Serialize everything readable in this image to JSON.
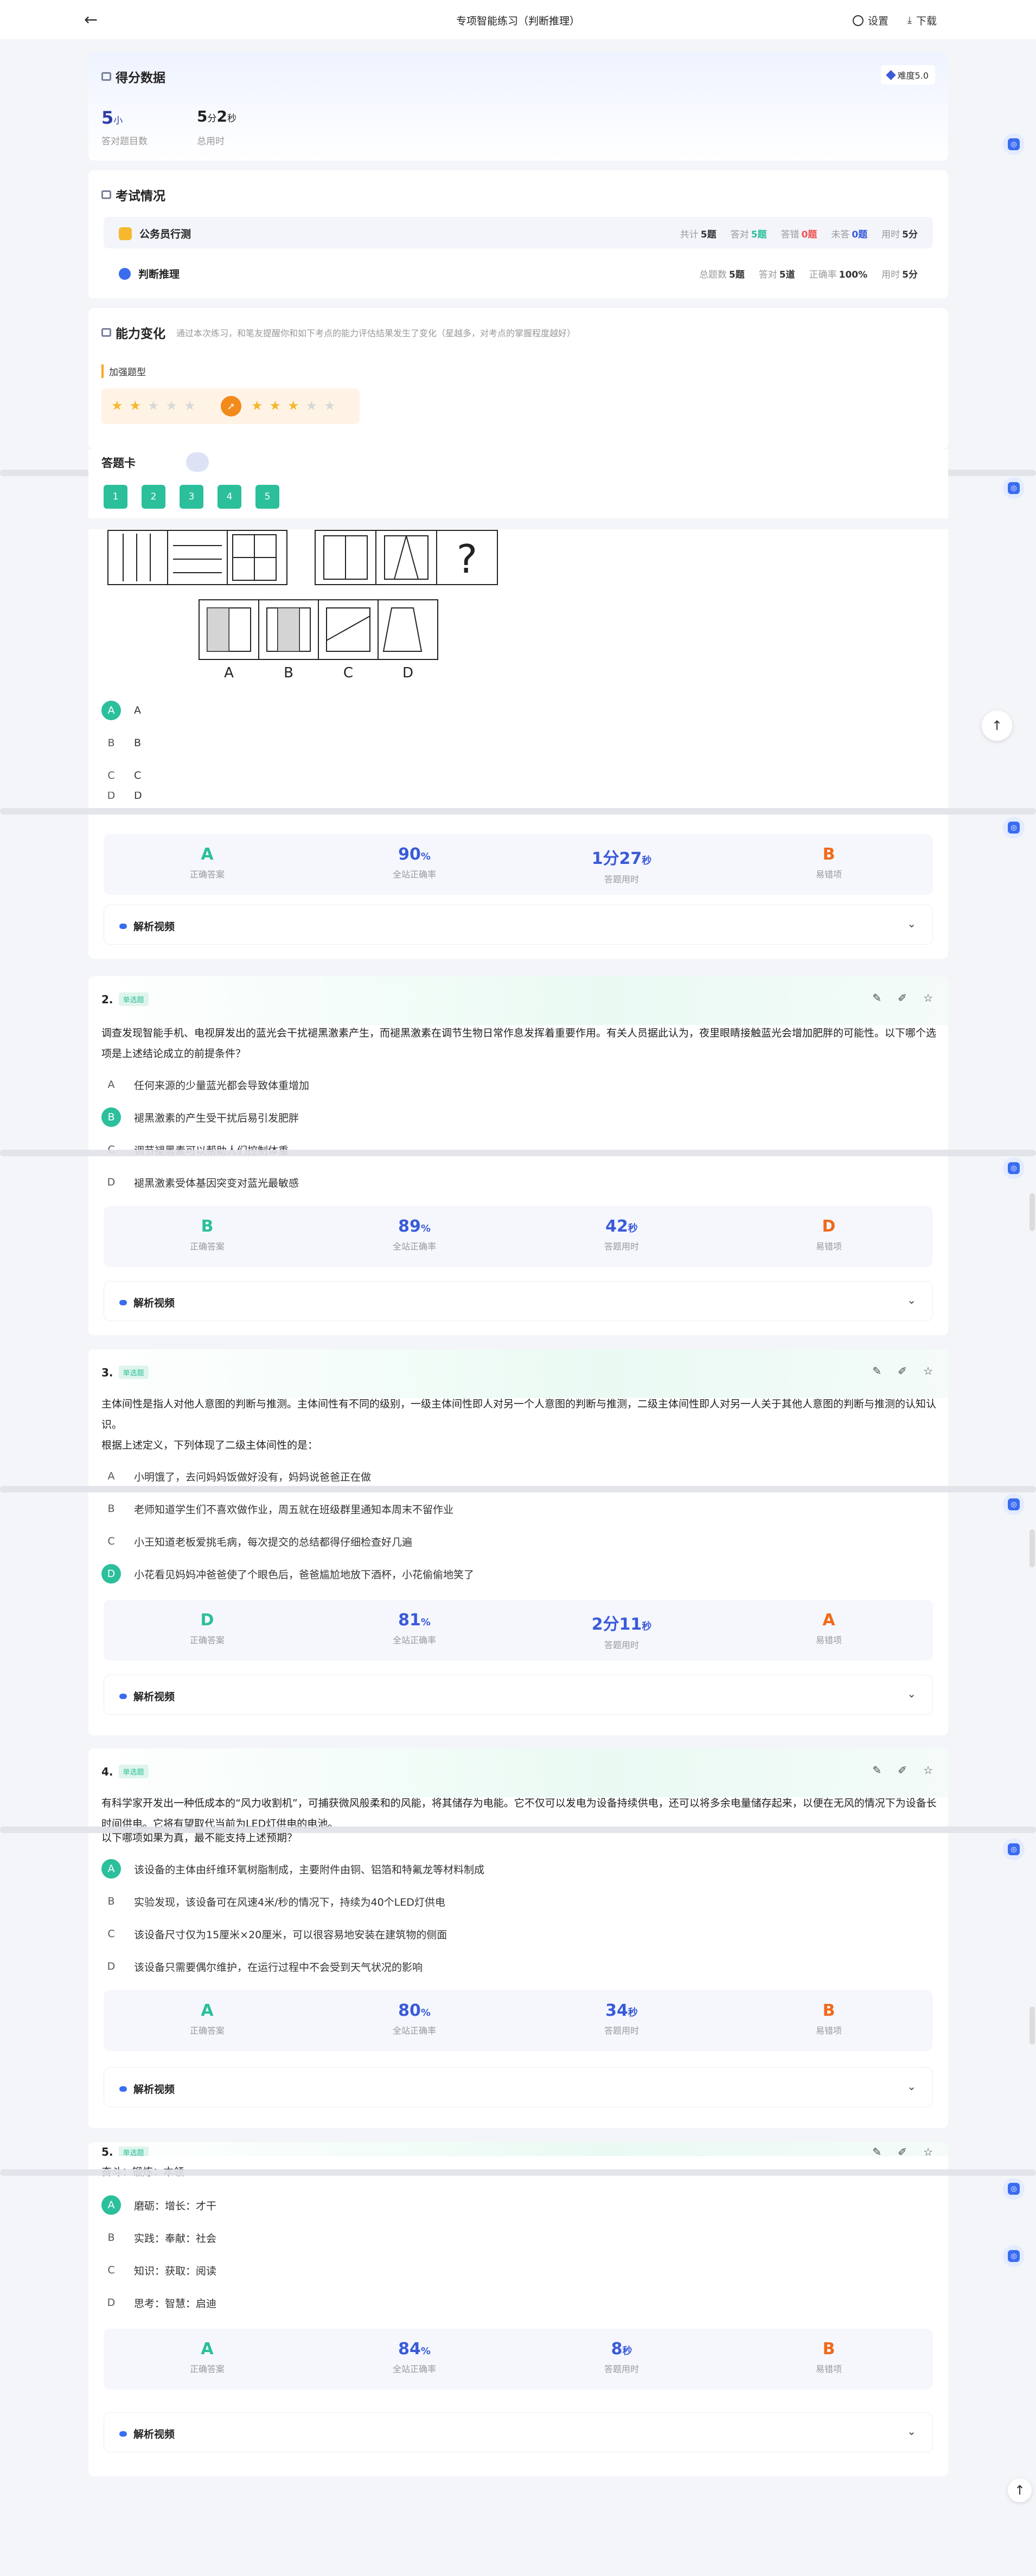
{
  "header": {
    "back": "←",
    "title": "专项智能练习（判断推理）",
    "settings": "设置",
    "download": "下载"
  },
  "score": {
    "title": "得分数据",
    "difficulty": "难度5.0",
    "correct_num": "5",
    "correct_unit": "小",
    "correct_label": "答对题目数",
    "time_min": "5",
    "time_min_unit": "分",
    "time_sec": "2",
    "time_sec_unit": "秒",
    "time_label": "总用时"
  },
  "exam": {
    "title": "考试情况",
    "row1": {
      "label": "公务员行测",
      "total_l": "共计",
      "total": "5题",
      "right_l": "答对",
      "right": "5题",
      "wrong_l": "答错",
      "wrong": "0题",
      "undone_l": "未答",
      "undone": "0题",
      "time_l": "用时",
      "time": "5分"
    },
    "row2": {
      "label": "判断推理",
      "total_l": "总题数",
      "total": "5题",
      "right_l": "答对",
      "right": "5道",
      "rate_l": "正确率",
      "rate": "100%",
      "time_l": "用时",
      "time": "5分"
    }
  },
  "ability": {
    "title": "能力变化",
    "desc": "通过本次练习，和笔友提醒你和如下考点的能力评估结果发生了变化（星越多，对考点的掌握程度越好）",
    "tag": "加强题型"
  },
  "answer_card": {
    "title": "答题卡",
    "items": [
      "1",
      "2",
      "3",
      "4",
      "5"
    ]
  },
  "q1": {
    "figure_labels": [
      "A",
      "B",
      "C",
      "D"
    ],
    "qmark": "?",
    "options": [
      {
        "l": "A",
        "t": "A"
      },
      {
        "l": "B",
        "t": "B"
      },
      {
        "l": "C",
        "t": "C"
      },
      {
        "l": "D",
        "t": "D"
      }
    ],
    "summary": [
      {
        "v": "A",
        "u": "",
        "l": "正确答案",
        "c": "#2bbf9b"
      },
      {
        "v": "90",
        "u": "%",
        "l": "全站正确率",
        "c": "#3a5bd9"
      },
      {
        "v": "1分27",
        "u": "秒",
        "l": "答题用时",
        "c": "#3a5bd9"
      },
      {
        "v": "B",
        "u": "",
        "l": "易错项",
        "c": "#f06a1a"
      }
    ],
    "video": "解析视频"
  },
  "q2": {
    "num": "2.",
    "tag": "单选题",
    "text": "调查发现智能手机、电视屏发出的蓝光会干扰褪黑激素产生，而褪黑激素在调节生物日常作息发挥着重要作用。有关人员据此认为，夜里眼睛接触蓝光会增加肥胖的可能性。以下哪个选项是上述结论成立的前提条件？",
    "options": [
      {
        "l": "A",
        "t": "任何来源的少量蓝光都会导致体重增加"
      },
      {
        "l": "B",
        "t": "褪黑激素的产生受干扰后易引发肥胖"
      },
      {
        "l": "C",
        "t": "调节褪黑素可以帮助人们控制体重"
      },
      {
        "l": "D",
        "t": "褪黑激素受体基因突变对蓝光最敏感"
      }
    ],
    "summary": [
      {
        "v": "B",
        "u": "",
        "l": "正确答案",
        "c": "#2bbf9b"
      },
      {
        "v": "89",
        "u": "%",
        "l": "全站正确率",
        "c": "#3a5bd9"
      },
      {
        "v": "42",
        "u": "秒",
        "l": "答题用时",
        "c": "#3a5bd9"
      },
      {
        "v": "D",
        "u": "",
        "l": "易错项",
        "c": "#f06a1a"
      }
    ],
    "video": "解析视频"
  },
  "q3": {
    "num": "3.",
    "tag": "单选题",
    "text": "主体间性是指人对他人意图的判断与推测。主体间性有不同的级别，一级主体间性即人对另一个人意图的判断与推测，二级主体间性即人对另一人关于其他人意图的判断与推测的认知认识。",
    "text2": "根据上述定义，下列体现了二级主体间性的是：",
    "options": [
      {
        "l": "A",
        "t": "小明饿了，去问妈妈饭做好没有，妈妈说爸爸正在做"
      },
      {
        "l": "B",
        "t": "老师知道学生们不喜欢做作业，周五就在班级群里通知本周末不留作业"
      },
      {
        "l": "C",
        "t": "小王知道老板爱挑毛病，每次提交的总结都得仔细检查好几遍"
      },
      {
        "l": "D",
        "t": "小花看见妈妈冲爸爸使了个眼色后，爸爸尴尬地放下酒杯，小花偷偷地笑了"
      }
    ],
    "summary": [
      {
        "v": "D",
        "u": "",
        "l": "正确答案",
        "c": "#2bbf9b"
      },
      {
        "v": "81",
        "u": "%",
        "l": "全站正确率",
        "c": "#3a5bd9"
      },
      {
        "v": "2分11",
        "u": "秒",
        "l": "答题用时",
        "c": "#3a5bd9"
      },
      {
        "v": "A",
        "u": "",
        "l": "易错项",
        "c": "#f06a1a"
      }
    ],
    "video": "解析视频"
  },
  "q4": {
    "num": "4.",
    "tag": "单选题",
    "text": "有科学家开发出一种低成本的“风力收割机”，可捕获微风般柔和的风能，将其储存为电能。它不仅可以发电为设备持续供电，还可以将多余电量储存起来，以便在无风的情况下为设备长时间供电。它将有望取代当前为LED灯供电的电池。",
    "text2": "以下哪项如果为真，最不能支持上述预期？",
    "options": [
      {
        "l": "A",
        "t": "该设备的主体由纤维环氧树脂制成，主要附件由铜、铝箔和特氟龙等材料制成"
      },
      {
        "l": "B",
        "t": "实验发现，该设备可在风速4米/秒的情况下，持续为40个LED灯供电"
      },
      {
        "l": "C",
        "t": "该设备尺寸仅为15厘米×20厘米，可以很容易地安装在建筑物的侧面"
      },
      {
        "l": "D",
        "t": "该设备只需要偶尔维护，在运行过程中不会受到天气状况的影响"
      }
    ],
    "summary": [
      {
        "v": "A",
        "u": "",
        "l": "正确答案",
        "c": "#2bbf9b"
      },
      {
        "v": "80",
        "u": "%",
        "l": "全站正确率",
        "c": "#3a5bd9"
      },
      {
        "v": "34",
        "u": "秒",
        "l": "答题用时",
        "c": "#3a5bd9"
      },
      {
        "v": "B",
        "u": "",
        "l": "易错项",
        "c": "#f06a1a"
      }
    ],
    "video": "解析视频"
  },
  "q5": {
    "num": "5.",
    "tag": "单选题",
    "text": "奋斗：锻炼：本领",
    "options": [
      {
        "l": "A",
        "t": "磨砺：增长：才干"
      },
      {
        "l": "B",
        "t": "实践：奉献：社会"
      },
      {
        "l": "C",
        "t": "知识：获取：阅读"
      },
      {
        "l": "D",
        "t": "思考：智慧：启迪"
      }
    ],
    "summary": [
      {
        "v": "A",
        "u": "",
        "l": "正确答案",
        "c": "#2bbf9b"
      },
      {
        "v": "84",
        "u": "%",
        "l": "全站正确率",
        "c": "#3a5bd9"
      },
      {
        "v": "8",
        "u": "秒",
        "l": "答题用时",
        "c": "#3a5bd9"
      },
      {
        "v": "B",
        "u": "",
        "l": "易错项",
        "c": "#f06a1a"
      }
    ],
    "video": "解析视频"
  },
  "colors": {
    "accent": "#2bbf9b",
    "blue": "#3a5bd9",
    "orange": "#f06a1a",
    "star": "#f5b82e"
  }
}
